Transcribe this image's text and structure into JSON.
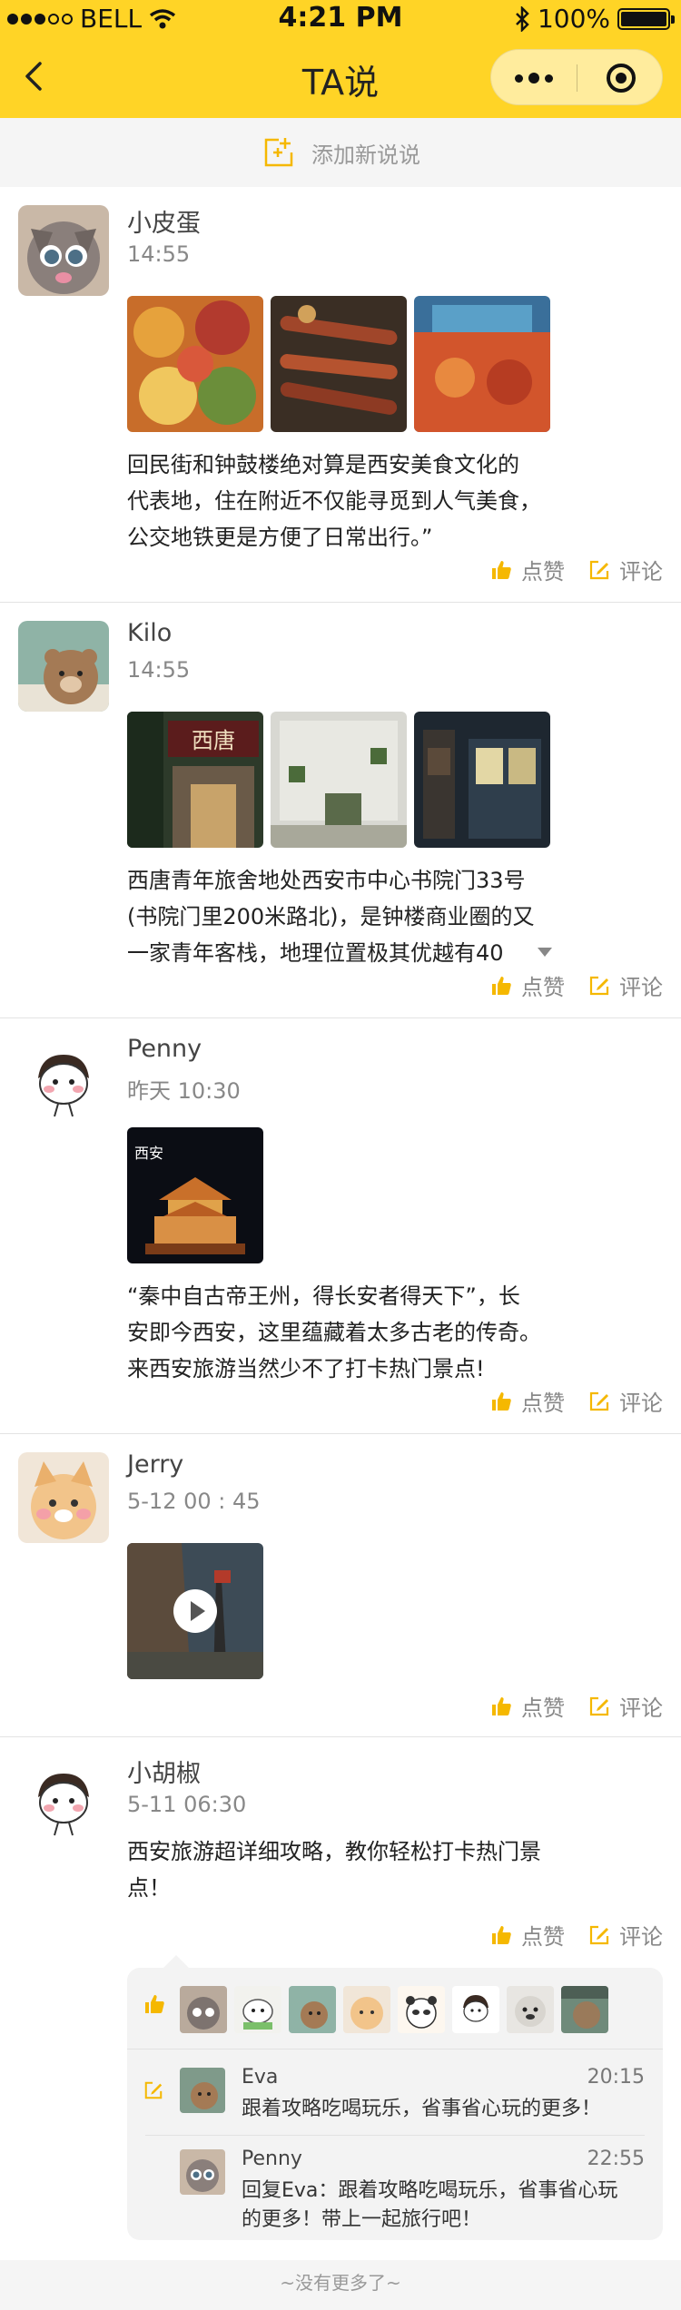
{
  "status": {
    "carrier": "BELL",
    "time": "4:21 PM",
    "battery": "100%",
    "battery_level": 1.0
  },
  "nav": {
    "title": "TA说"
  },
  "addbar": {
    "label": "添加新说说"
  },
  "actions": {
    "like": "点赞",
    "comment": "评论"
  },
  "colors": {
    "accent": "#FFD426",
    "icon": "#F5B800"
  },
  "posts": [
    {
      "name": "小皮蛋",
      "time": "14:55",
      "text": [
        "回民街和钟鼓楼绝对算是西安美食文化的",
        "代表地，住在附近不仅能寻觅到人气美食，",
        "公交地铁更是方便了日常出行。”"
      ]
    },
    {
      "name": "Kilo",
      "time": "14:55",
      "text": [
        "西唐青年旅舍地处西安市中心书院门33号",
        "(书院门里200米路北)，是钟楼商业圈的又",
        "一家青年客栈，地理位置极其优越有40"
      ],
      "photo_sign": "西唐"
    },
    {
      "name": "Penny",
      "time": "昨天 10:30",
      "text": [
        "“秦中自古帝王州，得长安者得天下”，长",
        "安即今西安，这里蕴藏着太多古老的传奇。",
        "来西安旅游当然少不了打卡热门景点!"
      ],
      "photo_sign": "西安"
    },
    {
      "name": "Jerry",
      "time": "5-12 00 : 45",
      "text": []
    },
    {
      "name": "小胡椒",
      "time": "5-11 06:30",
      "text": [
        "西安旅游超详细攻略，教你轻松打卡热门景",
        "点！"
      ]
    }
  ],
  "comments": [
    {
      "name": "Eva",
      "time": "20:15",
      "text": [
        "跟着攻略吃喝玩乐，省事省心玩的更多！"
      ]
    },
    {
      "name": "Penny",
      "time": "22:55",
      "text": [
        "回复Eva：跟着攻略吃喝玩乐，省事省心玩",
        "的更多！带上一起旅行吧！"
      ]
    }
  ],
  "footer": {
    "text": "~没有更多了~"
  }
}
